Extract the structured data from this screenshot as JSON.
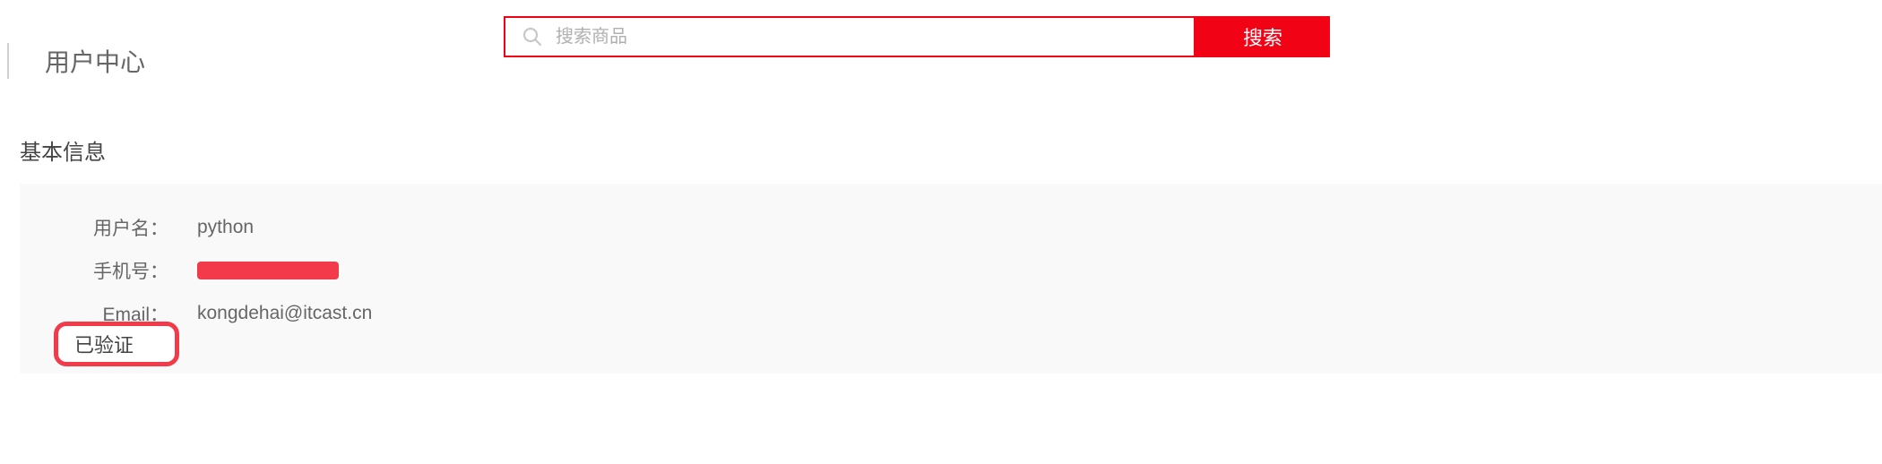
{
  "header": {
    "page_title": "用户中心",
    "search": {
      "placeholder": "搜索商品",
      "button_label": "搜索"
    }
  },
  "section": {
    "title": "基本信息"
  },
  "user_info": {
    "username_label": "用户名：",
    "username_value": "python",
    "phone_label": "手机号：",
    "email_label": "Email：",
    "email_value": "kongdehai@itcast.cn",
    "verify_status": "已验证"
  }
}
